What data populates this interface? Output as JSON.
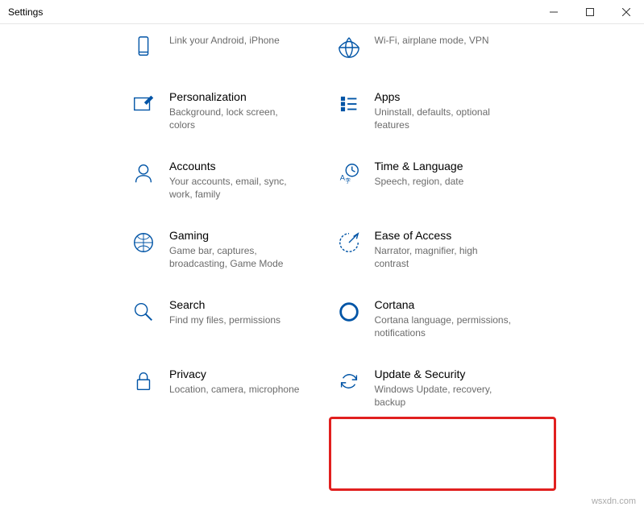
{
  "window": {
    "title": "Settings"
  },
  "tiles": {
    "phone": {
      "name": "",
      "desc": "Link your Android, iPhone"
    },
    "network": {
      "name": "",
      "desc": "Wi-Fi, airplane mode, VPN"
    },
    "personalization": {
      "name": "Personalization",
      "desc": "Background, lock screen, colors"
    },
    "apps": {
      "name": "Apps",
      "desc": "Uninstall, defaults, optional features"
    },
    "accounts": {
      "name": "Accounts",
      "desc": "Your accounts, email, sync, work, family"
    },
    "time": {
      "name": "Time & Language",
      "desc": "Speech, region, date"
    },
    "gaming": {
      "name": "Gaming",
      "desc": "Game bar, captures, broadcasting, Game Mode"
    },
    "ease": {
      "name": "Ease of Access",
      "desc": "Narrator, magnifier, high contrast"
    },
    "search": {
      "name": "Search",
      "desc": "Find my files, permissions"
    },
    "cortana": {
      "name": "Cortana",
      "desc": "Cortana language, permissions, notifications"
    },
    "privacy": {
      "name": "Privacy",
      "desc": "Location, camera, microphone"
    },
    "update": {
      "name": "Update & Security",
      "desc": "Windows Update, recovery, backup"
    }
  },
  "watermark": "wsxdn.com"
}
